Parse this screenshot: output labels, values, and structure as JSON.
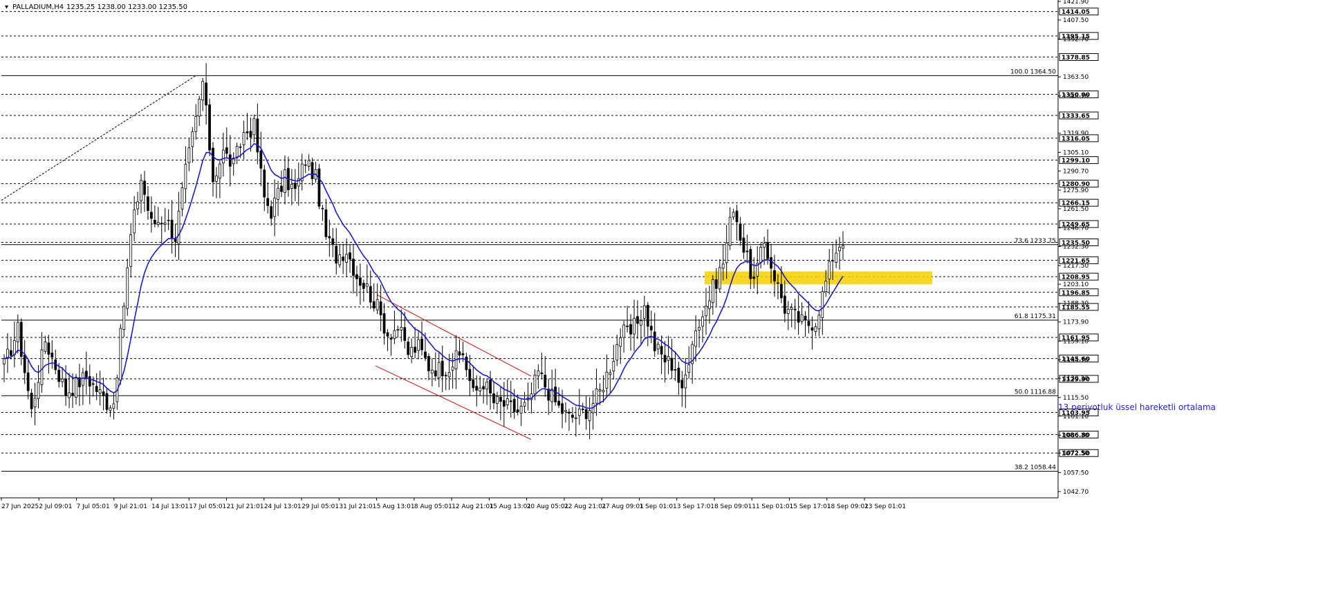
{
  "header": {
    "symbol": "PALLADIUM,H4",
    "ohlc": "1235.25 1238.00 1233.00 1235.50"
  },
  "annotation": "13 periyotluk üssel hareketli ortalama",
  "colors": {
    "background": "#ffffff",
    "candle": "#000000",
    "ema": "#1a1acc",
    "zone": "#f5d000",
    "channel": "#cc1111"
  },
  "chart_data": {
    "type": "candlestick",
    "ylim": [
      1040.0,
      1421.9
    ],
    "price_ticks": [
      "1421.90",
      "1407.50",
      "1392.70",
      "1363.50",
      "1348.70",
      "1319.90",
      "1305.10",
      "1290.70",
      "1275.90",
      "1261.50",
      "1246.70",
      "1232.30",
      "1217.50",
      "1203.10",
      "1188.30",
      "1173.90",
      "1159.10",
      "1144.70",
      "1130.30",
      "1115.50",
      "1101.10",
      "1086.30",
      "1072.50",
      "1057.50",
      "1042.70"
    ],
    "levels": [
      "1414.05",
      "1395.15",
      "1378.85",
      "1350.00",
      "1333.65",
      "1316.05",
      "1299.10",
      "1280.90",
      "1266.15",
      "1249.65",
      "1235.50",
      "1221.65",
      "1208.95",
      "1196.85",
      "1185.55",
      "1161.95",
      "1145.60",
      "1129.90",
      "1103.95",
      "1086.80",
      "1072.50"
    ],
    "current_price": "1235.50",
    "fibonacci": [
      {
        "label": "100.0 1364.50",
        "price": 1364.5
      },
      {
        "label": "73.6 1233.75",
        "price": 1233.75
      },
      {
        "label": "61.8 1175.31",
        "price": 1175.31
      },
      {
        "label": "50.0 1116.88",
        "price": 1116.88
      },
      {
        "label": "38.2 1058.44",
        "price": 1058.44
      }
    ],
    "time_labels": [
      "27 Jun 2025",
      "2 Jul 09:01",
      "7 Jul 05:01",
      "9 Jul 21:01",
      "14 Jul 13:01",
      "17 Jul 05:01",
      "21 Jul 21:01",
      "24 Jul 13:01",
      "29 Jul 05:01",
      "31 Jul 21:01",
      "5 Aug 13:01",
      "8 Aug 05:01",
      "12 Aug 21:01",
      "15 Aug 13:01",
      "20 Aug 05:01",
      "22 Aug 21:01",
      "27 Aug 09:01",
      "1 Sep 01:01",
      "3 Sep 17:01",
      "8 Sep 09:01",
      "11 Sep 01:01",
      "15 Sep 17:01",
      "18 Sep 09:01",
      "23 Sep 01:01"
    ],
    "bar_count": 305,
    "anchors": [
      [
        0,
        1140
      ],
      [
        4,
        1168
      ],
      [
        8,
        1105
      ],
      [
        12,
        1160
      ],
      [
        18,
        1120
      ],
      [
        24,
        1132
      ],
      [
        30,
        1112
      ],
      [
        32,
        1112
      ],
      [
        34,
        1162
      ],
      [
        37,
        1240
      ],
      [
        40,
        1285
      ],
      [
        43,
        1250
      ],
      [
        47,
        1255
      ],
      [
        50,
        1240
      ],
      [
        53,
        1290
      ],
      [
        56,
        1330
      ],
      [
        58,
        1360
      ],
      [
        61,
        1285
      ],
      [
        64,
        1305
      ],
      [
        67,
        1295
      ],
      [
        70,
        1320
      ],
      [
        73,
        1325
      ],
      [
        76,
        1270
      ],
      [
        78,
        1260
      ],
      [
        82,
        1285
      ],
      [
        85,
        1275
      ],
      [
        88,
        1300
      ],
      [
        91,
        1285
      ],
      [
        94,
        1240
      ],
      [
        97,
        1225
      ],
      [
        100,
        1230
      ],
      [
        103,
        1210
      ],
      [
        106,
        1200
      ],
      [
        109,
        1185
      ],
      [
        112,
        1165
      ],
      [
        115,
        1170
      ],
      [
        118,
        1150
      ],
      [
        121,
        1155
      ],
      [
        124,
        1140
      ],
      [
        127,
        1138
      ],
      [
        130,
        1140
      ],
      [
        134,
        1150
      ],
      [
        137,
        1118
      ],
      [
        140,
        1128
      ],
      [
        143,
        1112
      ],
      [
        146,
        1110
      ],
      [
        150,
        1105
      ],
      [
        153,
        1110
      ],
      [
        156,
        1135
      ],
      [
        159,
        1120
      ],
      [
        162,
        1108
      ],
      [
        165,
        1100
      ],
      [
        168,
        1102
      ],
      [
        171,
        1108
      ],
      [
        174,
        1120
      ],
      [
        177,
        1140
      ],
      [
        180,
        1165
      ],
      [
        183,
        1165
      ],
      [
        187,
        1185
      ],
      [
        190,
        1155
      ],
      [
        193,
        1145
      ],
      [
        196,
        1140
      ],
      [
        198,
        1118
      ],
      [
        201,
        1162
      ],
      [
        204,
        1180
      ],
      [
        207,
        1200
      ],
      [
        210,
        1220
      ],
      [
        213,
        1265
      ],
      [
        216,
        1230
      ],
      [
        219,
        1205
      ],
      [
        222,
        1235
      ],
      [
        225,
        1210
      ],
      [
        228,
        1185
      ],
      [
        231,
        1178
      ],
      [
        234,
        1172
      ],
      [
        237,
        1175
      ],
      [
        240,
        1205
      ],
      [
        242,
        1225
      ],
      [
        244,
        1235
      ],
      [
        245,
        1233
      ]
    ]
  }
}
